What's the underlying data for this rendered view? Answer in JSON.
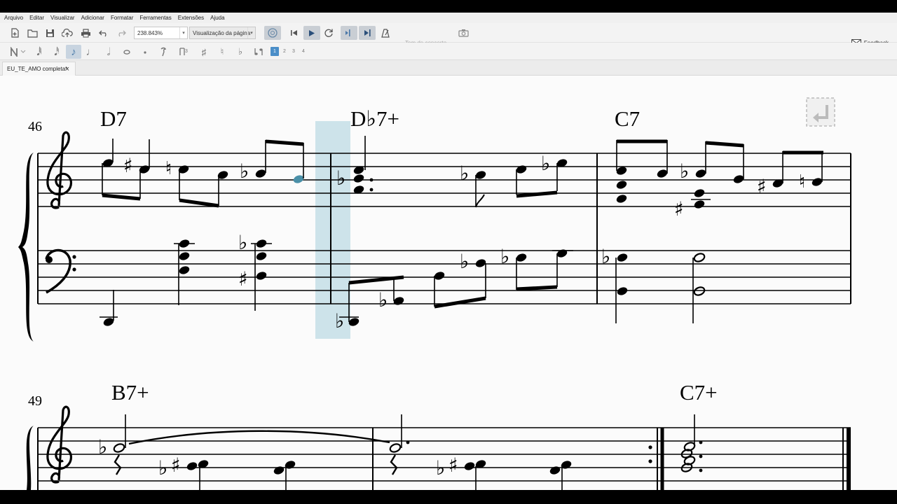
{
  "menu": [
    "Arquivo",
    "Editar",
    "Visualizar",
    "Adicionar",
    "Formatar",
    "Ferramentas",
    "Extensões",
    "Ajuda"
  ],
  "toolbar": {
    "zoom_value": "238.843%",
    "view_mode": "Visualização da página",
    "concert_pitch": "Tom de concerto",
    "feedback": "Feedback"
  },
  "voice_numbers": [
    "1",
    "2",
    "3",
    "4"
  ],
  "tab": {
    "title": "EU_TE_AMO completa*",
    "close": "×"
  },
  "score": {
    "system1": {
      "measure_number": "46",
      "chords": [
        "D7",
        "D♭7+",
        "C7"
      ]
    },
    "system2": {
      "measure_number": "49",
      "chords": [
        "B7+",
        "C7+"
      ]
    }
  },
  "colors": {
    "selection": "#4a90a8",
    "playback_cursor": "#a8cfdc",
    "accent": "#2c6fa8"
  }
}
